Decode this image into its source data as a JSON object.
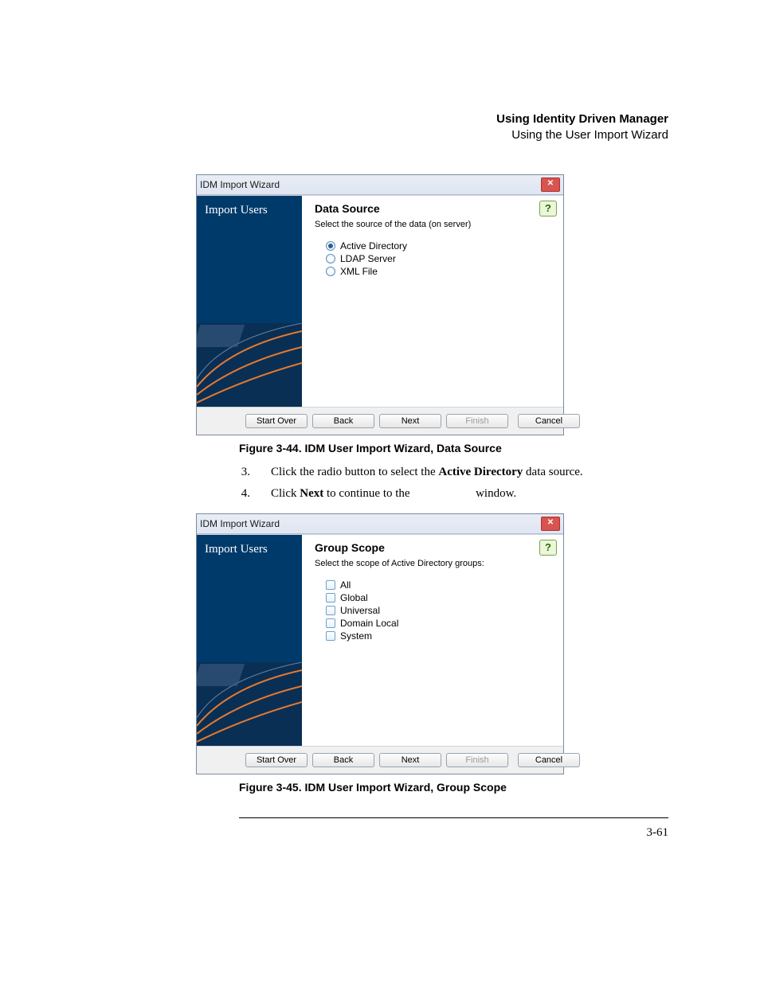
{
  "header": {
    "title_bold": "Using Identity Driven Manager",
    "subtitle": "Using the User Import Wizard"
  },
  "wizard1": {
    "window_title": "IDM Import Wizard",
    "sidebar_title": "Import Users",
    "content_title": "Data Source",
    "content_sub": "Select the source of the data (on server)",
    "options": {
      "opt1": "Active Directory",
      "opt2": "LDAP Server",
      "opt3": "XML File"
    },
    "buttons": {
      "start_over": "Start Over",
      "back": "Back",
      "next": "Next",
      "finish": "Finish",
      "cancel": "Cancel"
    }
  },
  "caption1": "Figure 3-44. IDM User Import Wizard, Data Source",
  "steps": {
    "s3num": "3.",
    "s3a": "Click the radio button to select the ",
    "s3b": "Active Directory",
    "s3c": " data source.",
    "s4num": "4.",
    "s4a": "Click ",
    "s4b": "Next",
    "s4c": " to continue to the ",
    "s4d": " window."
  },
  "wizard2": {
    "window_title": "IDM Import Wizard",
    "sidebar_title": "Import Users",
    "content_title": "Group Scope",
    "content_sub": "Select the scope of Active Directory groups:",
    "options": {
      "opt1": "All",
      "opt2": "Global",
      "opt3": "Universal",
      "opt4": "Domain Local",
      "opt5": "System"
    },
    "buttons": {
      "start_over": "Start Over",
      "back": "Back",
      "next": "Next",
      "finish": "Finish",
      "cancel": "Cancel"
    }
  },
  "caption2": "Figure 3-45. IDM User Import Wizard, Group Scope",
  "page_number": "3-61"
}
